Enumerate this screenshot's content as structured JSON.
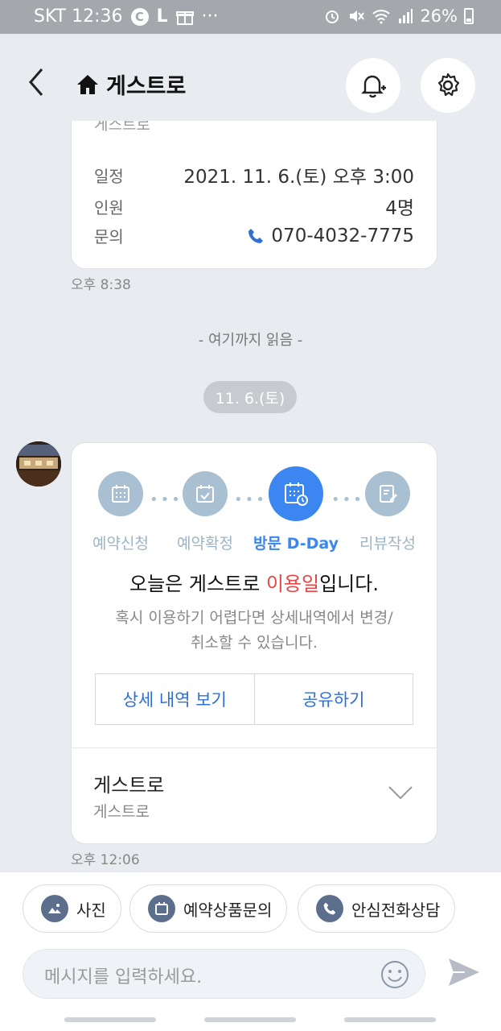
{
  "status_bar": {
    "carrier_time": "SKT 12:36",
    "c_badge": "C",
    "l_badge": "L",
    "dots": "···",
    "battery": "26%"
  },
  "header": {
    "title": "게스트로"
  },
  "booking_card": {
    "peek_text": "게스트로",
    "rows": [
      {
        "label": "일정",
        "value": "2021. 11. 6.(토) 오후 3:00"
      },
      {
        "label": "인원",
        "value": "4명"
      },
      {
        "label": "문의",
        "value": "070-4032-7775"
      }
    ],
    "time": "오후 8:38"
  },
  "read_marker": "- 여기까지 읽음 -",
  "date_pill": "11. 6.(토)",
  "status_card": {
    "steps": [
      {
        "label": "예약신청",
        "icon": "calendar-icon"
      },
      {
        "label": "예약확정",
        "icon": "calendar-check-icon"
      },
      {
        "label": "방문 D-Day",
        "icon": "calendar-clock-icon"
      },
      {
        "label": "리뷰작성",
        "icon": "review-edit-icon"
      }
    ],
    "headline_pre": "오늘은 게스트로 ",
    "headline_highlight": "이용일",
    "headline_post": "입니다.",
    "desc_line1": "혹시 이용하기 어렵다면 상세내역에서 변경/",
    "desc_line2": "취소할 수 있습니다.",
    "detail_button": "상세 내역 보기",
    "share_button": "공유하기",
    "shop_name": "게스트로",
    "shop_sub": "게스트로",
    "time": "오후 12:06",
    "highlight_color": "#e84545",
    "accent_color": "#3b86f0"
  },
  "quick_actions": [
    {
      "label": "사진",
      "icon": "photo-icon"
    },
    {
      "label": "예약상품문의",
      "icon": "calendar-icon"
    },
    {
      "label": "안심전화상담",
      "icon": "phone-icon"
    }
  ],
  "composer": {
    "placeholder": "메시지를 입력하세요."
  }
}
